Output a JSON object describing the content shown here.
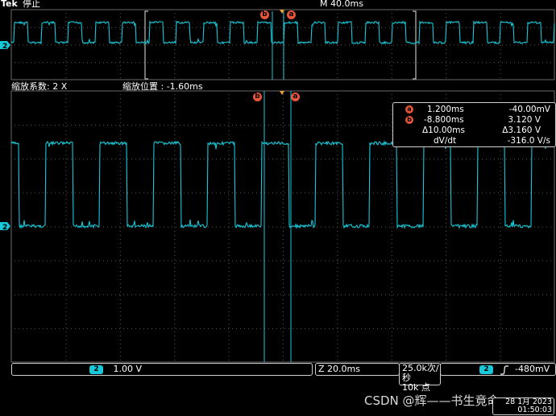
{
  "header": {
    "brand": "Tek",
    "state": "停止",
    "timebase": "M 40.0ms"
  },
  "zoom": {
    "factor_label": "缩放系数: 2 X",
    "position_label": "缩放位置 :  -1.60ms"
  },
  "markers": {
    "a": "a",
    "b": "b",
    "channel": "2"
  },
  "cursor_readout": {
    "a_time": "1.200ms",
    "a_value": "-40.00mV",
    "b_time": "-8.800ms",
    "b_value": "3.120 V",
    "delta_time": "Δ10.00ms",
    "delta_value": "Δ3.160 V",
    "slope_label": "dV/dt",
    "slope_value": "-316.0 V/s"
  },
  "status_bar": {
    "channel": "2",
    "ch_scale": "1.00 V",
    "zoom_scale": "Z 20.0ms",
    "sample_rate": "25.0k次/秒",
    "record_length": "10k 点",
    "trigger_channel": "2",
    "trigger_slope_icon": "rising-edge-icon",
    "trigger_level": "-480mV"
  },
  "datetime": {
    "date": "28 1月 2023",
    "time": "01:50:03"
  },
  "watermark": "CSDN @辉——书生竟命",
  "colors": {
    "trace": "#16c8d8",
    "cursor": "#16c8d8",
    "marker": "#e8553a",
    "trigger": "#f0a030",
    "grid": "#5a5a5a"
  }
}
